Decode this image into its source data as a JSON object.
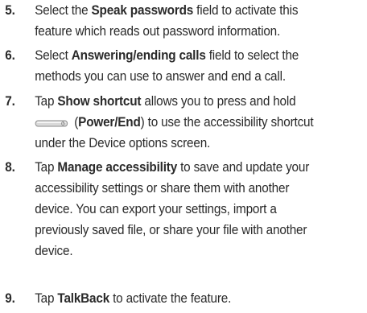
{
  "items": [
    {
      "number": "5.",
      "lines": [
        {
          "pre": "Select the ",
          "bold": "Speak passwords",
          "post": " field to activate this"
        },
        {
          "text": "feature which reads out password information."
        }
      ]
    },
    {
      "number": "6.",
      "lines": [
        {
          "pre": "Select ",
          "bold": "Answering/ending calls",
          "post": " field to select the"
        },
        {
          "text": "methods you can use to answer and end a call."
        }
      ]
    },
    {
      "number": "7.",
      "lines": [
        {
          "pre": "Tap ",
          "bold": "Show shortcut",
          "post": " allows you to press and hold"
        },
        {
          "key_open": " (",
          "bold": "Power/End",
          "post": ") to use the accessibility shortcut"
        },
        {
          "text": "under the Device options screen."
        }
      ]
    },
    {
      "number": "8.",
      "lines": [
        {
          "pre": "Tap ",
          "bold": "Manage accessibility",
          "post": " to save and update your"
        },
        {
          "text": "accessibility settings or share them with another"
        },
        {
          "text": "device. You can export your settings, import a"
        },
        {
          "text": "previously saved file, or share your file with another"
        },
        {
          "text": "device."
        }
      ]
    },
    {
      "number": "9.",
      "lines": [
        {
          "pre": "Tap ",
          "bold": "TalkBack",
          "post": " to activate the feature."
        }
      ]
    }
  ],
  "icons": {
    "power_key": "power-end-key-icon"
  }
}
